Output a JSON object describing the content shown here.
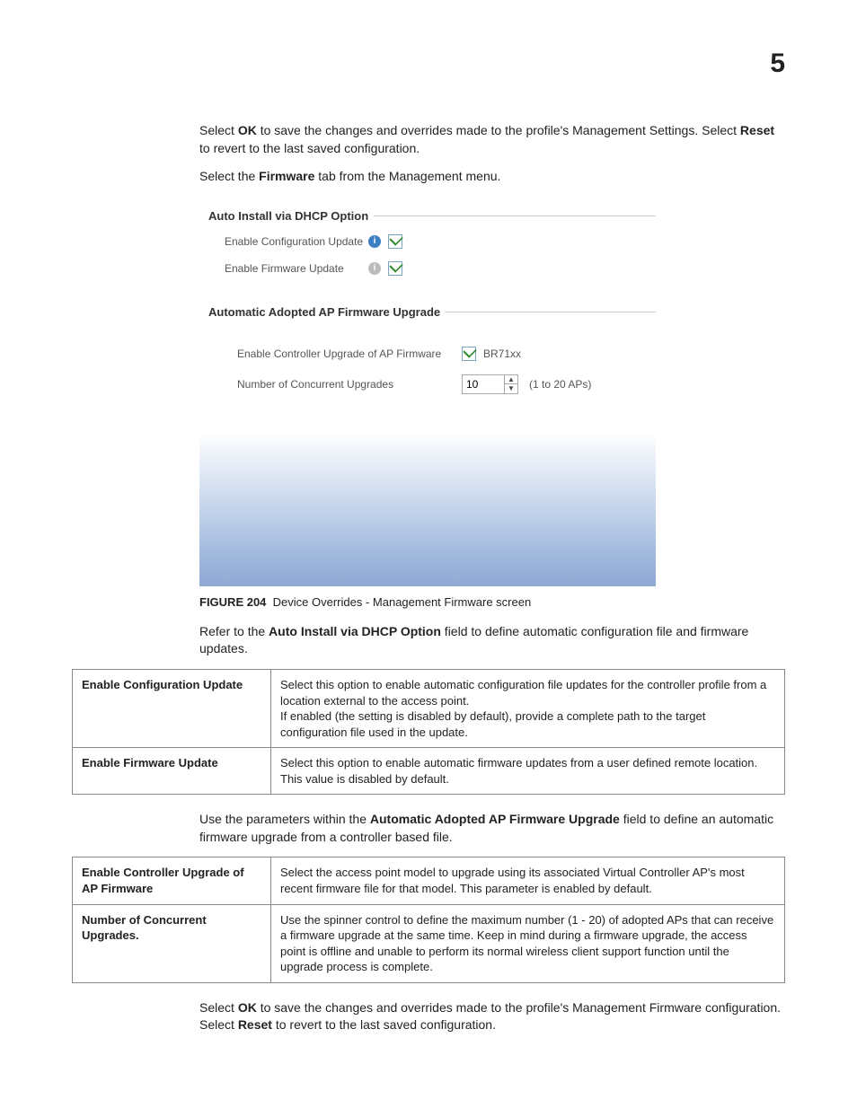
{
  "page_number": "5",
  "intro": {
    "p1_a": "Select ",
    "p1_ok": "OK",
    "p1_b": " to save the changes and overrides made to the profile's Management Settings. Select ",
    "p1_reset": "Reset",
    "p1_c": " to revert to the last saved configuration.",
    "p2_a": "Select the ",
    "p2_fw": "Firmware",
    "p2_b": " tab from the Management menu."
  },
  "shot": {
    "group1_title": "Auto Install via DHCP Option",
    "row1_label": "Enable Configuration Update",
    "row2_label": "Enable Firmware Update",
    "group2_title": "Automatic Adopted AP Firmware Upgrade",
    "row3_label": "Enable Controller Upgrade of AP Firmware",
    "row3_val": "BR71xx",
    "row4_label": "Number of Concurrent Upgrades",
    "spinner_val": "10",
    "spinner_hint": "(1 to 20 APs)"
  },
  "figure": {
    "label": "FIGURE 204",
    "caption": "Device Overrides - Management Firmware screen"
  },
  "mid": {
    "p_a": "Refer to the ",
    "p_bold": "Auto Install via DHCP Option",
    "p_b": " field to define automatic configuration file and firmware updates."
  },
  "table1": {
    "r1_l": "Enable Configuration Update",
    "r1_r": "Select this option to enable automatic configuration file updates for the controller profile from a location external to the access point.\nIf enabled (the setting is disabled by default), provide a complete path to the target configuration file used in the update.",
    "r2_l": "Enable Firmware Update",
    "r2_r": "Select this option to enable automatic firmware updates from a user defined remote location. This value is disabled by default."
  },
  "mid2": {
    "p_a": "Use the parameters within the ",
    "p_bold": "Automatic Adopted AP Firmware Upgrade",
    "p_b": " field to define an automatic firmware upgrade from a controller based file."
  },
  "table2": {
    "r1_l": "Enable Controller Upgrade of AP Firmware",
    "r1_r": "Select the access point model to upgrade using its associated Virtual Controller AP's most recent firmware file for that model. This parameter is enabled by default.",
    "r2_l": "Number of Concurrent Upgrades.",
    "r2_r": "Use the spinner control to define the maximum number (1 - 20) of adopted APs that can receive a firmware upgrade at the same time. Keep in mind during a firmware upgrade, the access point is offline and unable to perform its normal wireless client support function until the upgrade process is complete."
  },
  "outro": {
    "p_a": "Select ",
    "p_ok": "OK",
    "p_b": " to save the changes and overrides made to the profile's Management Firmware configuration. Select ",
    "p_reset": "Reset",
    "p_c": " to revert to the last saved configuration."
  }
}
